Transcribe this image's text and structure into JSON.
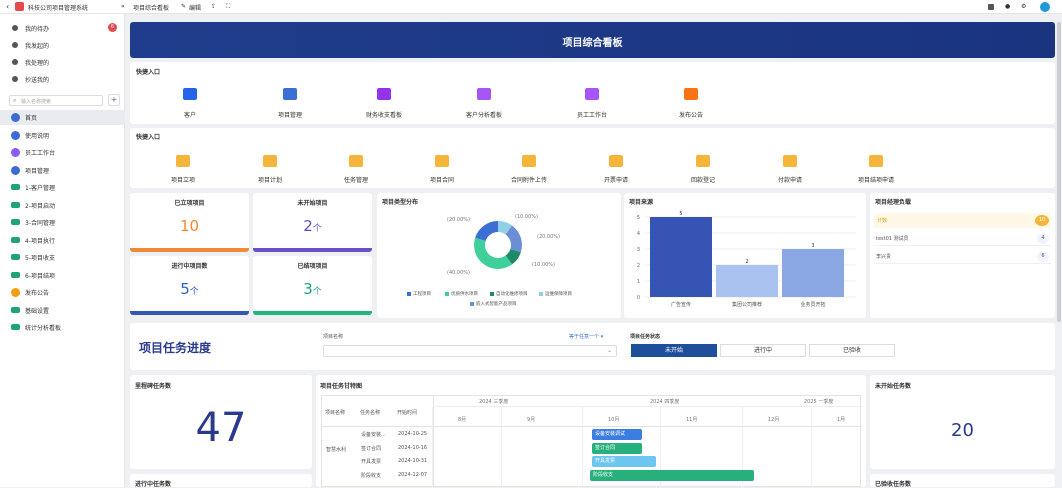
{
  "topbar": {
    "app_title": "科技公司项目管理系统",
    "tab_title": "项目综合看板",
    "edit_label": "编辑"
  },
  "sidebar": {
    "top_items": [
      {
        "label": "我的待办",
        "badge": "6"
      },
      {
        "label": "我发起的"
      },
      {
        "label": "我处理的"
      },
      {
        "label": "抄送我的"
      }
    ],
    "search_placeholder": "输入名称搜索",
    "nav": [
      {
        "label": "首页",
        "color": "#3d6bd6"
      },
      {
        "label": "使用说明",
        "color": "#3d6bd6"
      },
      {
        "label": "员工工作台",
        "color": "#8b5cf6"
      },
      {
        "label": "项目管理",
        "color": "#3d6bd6"
      },
      {
        "label": "1-客户管理",
        "color": "#1fa37a"
      },
      {
        "label": "2-项目启动",
        "color": "#1fa37a"
      },
      {
        "label": "3-合同管理",
        "color": "#1fa37a"
      },
      {
        "label": "4-项目执行",
        "color": "#1fa37a"
      },
      {
        "label": "5-项目收支",
        "color": "#1fa37a"
      },
      {
        "label": "6-项目结项",
        "color": "#1fa37a"
      },
      {
        "label": "发布公告",
        "color": "#f59e0b"
      },
      {
        "label": "基础设置",
        "color": "#1fa37a"
      },
      {
        "label": "统计分析看板",
        "color": "#1fa37a"
      }
    ]
  },
  "banner": {
    "title": "项目综合看板"
  },
  "quick1": {
    "title": "快捷入口",
    "items": [
      {
        "label": "客户",
        "color": "#2563eb"
      },
      {
        "label": "项目管理",
        "color": "#3b6fd4"
      },
      {
        "label": "财务收支看板",
        "color": "#9333ea"
      },
      {
        "label": "客户分析看板",
        "color": "#a855f7"
      },
      {
        "label": "员工工作台",
        "color": "#a855f7"
      },
      {
        "label": "发布公告",
        "color": "#f97316"
      }
    ]
  },
  "quick2": {
    "title": "快捷入口",
    "items": [
      {
        "label": "项目立项",
        "color": "#f5b43a"
      },
      {
        "label": "项目计划",
        "color": "#f5b43a"
      },
      {
        "label": "任务管理",
        "color": "#f5b43a"
      },
      {
        "label": "项目合同",
        "color": "#f5b43a"
      },
      {
        "label": "合同附件上传",
        "color": "#f5b43a"
      },
      {
        "label": "开票申请",
        "color": "#f5b43a"
      },
      {
        "label": "回款登记",
        "color": "#f5b43a"
      },
      {
        "label": "付款申请",
        "color": "#f5b43a"
      },
      {
        "label": "项目结项申请",
        "color": "#f5b43a"
      }
    ]
  },
  "stats": [
    {
      "title": "已立项项目",
      "value": "10",
      "unit": "",
      "color": "#f08a35",
      "bar": "#f08a35"
    },
    {
      "title": "未开始项目",
      "value": "2",
      "unit": "个",
      "color": "#5b50c8",
      "bar": "#6b4fc8"
    },
    {
      "title": "进行中项目数",
      "value": "5",
      "unit": "个",
      "color": "#2f5fbf",
      "bar": "#3457b6"
    },
    {
      "title": "已结项项目",
      "value": "3",
      "unit": "个",
      "color": "#1fa37a",
      "bar": "#22b37e"
    }
  ],
  "donut": {
    "title": "项目类型分布",
    "labels": [
      "(20.00%)",
      "(10.00%)",
      "(20.00%)",
      "(10.00%)",
      "(40.00%)"
    ],
    "legend": [
      {
        "label": "工程项目",
        "color": "#3b6fd4"
      },
      {
        "label": "优质供水项目",
        "color": "#3ecf9a"
      },
      {
        "label": "自动化维修项目",
        "color": "#1e8a6a"
      },
      {
        "label": "运维保障项目",
        "color": "#8fd0e8"
      },
      {
        "label": "嵌入式智能产品项目",
        "color": "#6b8fd4"
      }
    ]
  },
  "chart_data": {
    "type": "bar",
    "title": "项目来源",
    "categories": [
      "广告宣传",
      "集团公司推荐",
      "业务员开拓"
    ],
    "values": [
      5,
      2,
      3
    ],
    "ylim": [
      0,
      5
    ],
    "yticks": [
      "0",
      "1",
      "2",
      "3",
      "4",
      "5"
    ]
  },
  "manager_load": {
    "title": "项目经理负载",
    "header_label": "计数",
    "header_value": "10",
    "rows": [
      {
        "name": "test01 测试员",
        "count": "4"
      },
      {
        "name": "李兴贵",
        "count": "6"
      }
    ]
  },
  "progress": {
    "title": "项目任务进度",
    "name_label": "项目名称",
    "filter_label": "等于任意一个",
    "status_label": "项目任务状态",
    "status_tabs": [
      "未开始",
      "进行中",
      "已验收"
    ]
  },
  "task_total": {
    "title": "里程碑任务数",
    "value": "47"
  },
  "task_inprogress": {
    "title": "进行中任务数"
  },
  "task_notstarted": {
    "title": "未开始任务数",
    "value": "20"
  },
  "task_accepted": {
    "title": "已验收任务数"
  },
  "gantt": {
    "title": "项目任务甘特图",
    "columns": [
      "项目名称",
      "任务名称",
      "开始时间"
    ],
    "quarters": [
      "2024 三季度",
      "2024 四季度",
      "2025 一季度"
    ],
    "months": [
      "8月",
      "9月",
      "10月",
      "11月",
      "12月",
      "1月"
    ],
    "project": "智慧水利",
    "rows": [
      {
        "task": "设备安装...",
        "start": "2024-10-25",
        "bar": "设备安装调试",
        "color": "#3b7de0"
      },
      {
        "task": "签订合同",
        "start": "2024-10-16",
        "bar": "签订合同",
        "color": "#27b07c"
      },
      {
        "task": "开具发票",
        "start": "2024-10-31",
        "bar": "开具发票",
        "color": "#6cc6f0"
      },
      {
        "task": "阶段收支",
        "start": "2024-12-07",
        "bar": "阶段收支",
        "color": "#27b07c"
      }
    ]
  }
}
